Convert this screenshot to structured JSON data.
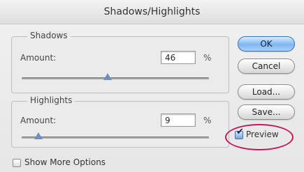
{
  "window": {
    "title": "Shadows/Highlights"
  },
  "shadows": {
    "title": "Shadows",
    "amount_label": "Amount:",
    "amount_value": "46",
    "unit": "%",
    "slider_percent": 46
  },
  "highlights": {
    "title": "Highlights",
    "amount_label": "Amount:",
    "amount_value": "9",
    "unit": "%",
    "slider_percent": 9
  },
  "buttons": {
    "ok": "OK",
    "cancel": "Cancel",
    "load": "Load...",
    "save": "Save..."
  },
  "options": {
    "preview_label": "Preview",
    "preview_checked": true,
    "show_more_label": "Show More Options",
    "show_more_checked": false
  },
  "colors": {
    "default_button": "#7fb6f0",
    "slider_thumb": "#6f8fbf",
    "annotation_ring": "#c2185b"
  }
}
